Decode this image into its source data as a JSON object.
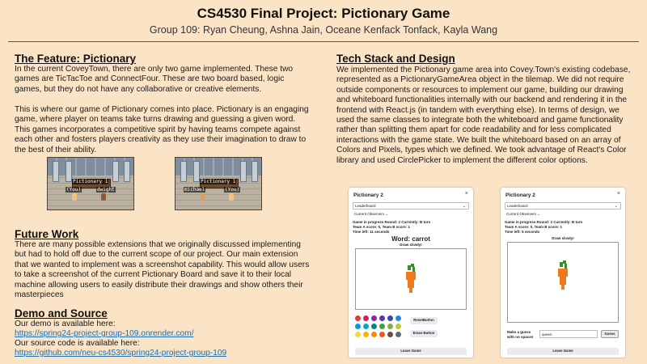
{
  "header": {
    "title": "CS4530 Final Project: Pictionary Game",
    "subtitle": "Group 109: Ryan Cheung, Ashna Jain, Oceane Kenfack Tonfack, Kayla Wang"
  },
  "feature": {
    "heading": "The Feature: Pictionary",
    "para1": "In the current CoveyTown, there are only two game implemented. These two games are TicTacToe and ConnectFour. These are two board based, logic games, but they do not have any collaborative or creative elements.",
    "para2": "This is where our game of Pictionary comes into place. Pictionary is an engaging game, where player on teams take turns drawing and guessing a given word. This games incorporates a competitive spirit by having teams compete against each other and fosters players creativity as they use their imagination to draw to the best of their ability."
  },
  "screens": {
    "left": {
      "sign": "Pictionary 1",
      "you": "(You)",
      "other": "dwight"
    },
    "right": {
      "sign": "Pictionary 1",
      "you": "(You)",
      "other": "michael"
    }
  },
  "future": {
    "heading": "Future Work",
    "para": "There are many possible extensions that we originally discussed implementing but had to hold off due to the current scope of our project. Our main extension that we wanted to implement was a screenshot capability. This would allow users to take a screenshot of the current Pictionary Board and save it to their local machine allowing users to easily distribute their drawings and show others their masterpieces"
  },
  "demo": {
    "heading": "Demo and Source",
    "demo_label": "Our demo is available here:",
    "demo_link": "https://spring24-project-group-109.onrender.com/",
    "source_label": "Our source code is available here:",
    "source_link": "https://github.com/neu-cs4530/spring24-project-group-109"
  },
  "tech": {
    "heading": "Tech Stack and Design",
    "para": "We implemented the Pictionary game area into Covey.Town's existing codebase, represented as a PictionaryGameArea object in the tilemap. We did not require outside components or resources to implement our game, building our drawing and whiteboard functionalities internally with our backend and rendering it in the frontend with React.js (in tandem with everything else). In terms of design, we used the same classes to integrate both the whiteboard and game functionality rather than splitting them apart for code readability and for less complicated interactions with the game state. We built the whiteboard based on an array of Colors and Pixels, types which we defined. We took advantage of React's Color library and used CirclePicker to implement the different color options."
  },
  "panel_left": {
    "title": "Pictionary 2",
    "close": "×",
    "leaderboard": "Leaderboard",
    "observers": "Current Observers",
    "status": "Game in progress Round: 2 Currently: B turn",
    "score": "Team A score: 0, Team B score: 1",
    "time": "Time left: 11 seconds",
    "word": "Word: carrot",
    "draw_slowly": "Draw slowly!",
    "reset": "ResetButton",
    "erase": "Erase Button",
    "leave": "Leave Game",
    "palette": [
      "#e53935",
      "#d81b60",
      "#8e24aa",
      "#5e35b1",
      "#3949ab",
      "#1e88e5",
      "#039be5",
      "#00acc1",
      "#00897b",
      "#43a047",
      "#7cb342",
      "#c0ca33",
      "#fdd835",
      "#ffb300",
      "#fb8c00",
      "#f4511e",
      "#6d4c41",
      "#546e7a"
    ]
  },
  "panel_right": {
    "title": "Pictionary 2",
    "close": "×",
    "leaderboard": "Leaderboard",
    "observers": "Current Observers",
    "status": "Game in progress Round: 2 Currently: B turn",
    "score": "Team A score: 0, Team B score: 1",
    "time": "Time left: 5 seconds",
    "draw_slowly": "Draw slowly!",
    "guess_label_1": "Make a guess",
    "guess_label_2": "with no spaces",
    "guess_value": "queen",
    "guess_button": "Guess",
    "leave": "Leave Game"
  }
}
